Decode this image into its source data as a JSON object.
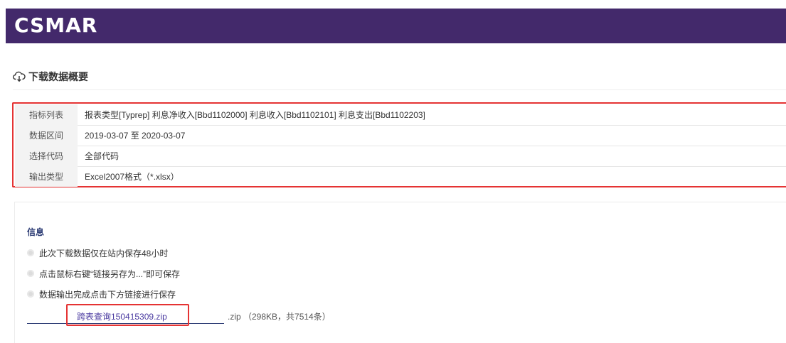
{
  "header": {
    "logo_text": "CSMAR",
    "bg_color": "#43296b"
  },
  "section": {
    "title": "下载数据概要",
    "icon": "cloud-download-icon"
  },
  "summary": {
    "rows": [
      {
        "label": "指标列表",
        "value": "报表类型[Typrep] 利息净收入[Bbd1102000] 利息收入[Bbd1102101] 利息支出[Bbd1102203]"
      },
      {
        "label": "数据区间",
        "value": "2019-03-07 至 2020-03-07"
      },
      {
        "label": "选择代码",
        "value": "全部代码"
      },
      {
        "label": "输出类型",
        "value": "Excel2007格式（*.xlsx）"
      }
    ]
  },
  "info": {
    "title": "信息",
    "notes": [
      "此次下载数据仅在站内保存48小时",
      "点击鼠标右键“链接另存为...”即可保存",
      "数据输出完成点击下方链接进行保存"
    ],
    "download": {
      "link_text": "跨表查询150415309.zip",
      "meta_text": ".zip （298KB，共7514条）"
    }
  },
  "colors": {
    "highlight": "#e53333",
    "link": "#4a3aa0",
    "title_navy": "#2a3a73"
  }
}
